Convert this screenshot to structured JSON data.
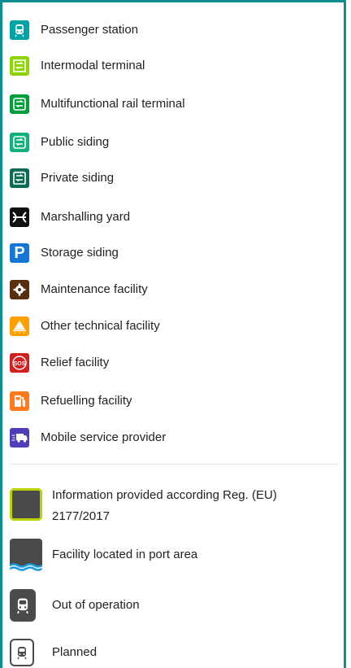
{
  "legend": {
    "items": [
      {
        "label": "Passenger station",
        "icon": "passenger-station-icon",
        "color": "#00a3a6"
      },
      {
        "label": "Intermodal terminal",
        "icon": "intermodal-terminal-icon",
        "color": "#8fd400"
      },
      {
        "label": "Multifunctional rail terminal",
        "icon": "multifunctional-terminal-icon",
        "color": "#009f3c"
      },
      {
        "label": "Public siding",
        "icon": "public-siding-icon",
        "color": "#12b07c"
      },
      {
        "label": "Private siding",
        "icon": "private-siding-icon",
        "color": "#0b6b55"
      },
      {
        "label": "Marshalling yard",
        "icon": "marshalling-yard-icon",
        "color": "#111111"
      },
      {
        "label": "Storage siding",
        "icon": "storage-siding-icon",
        "color": "#1477d6"
      },
      {
        "label": "Maintenance facility",
        "icon": "maintenance-facility-icon",
        "color": "#5a2f0e"
      },
      {
        "label": "Other technical facility",
        "icon": "other-technical-facility-icon",
        "color": "#ff9f00"
      },
      {
        "label": "Relief facility",
        "icon": "relief-facility-icon",
        "color": "#d21f1f"
      },
      {
        "label": "Refuelling facility",
        "icon": "refuelling-facility-icon",
        "color": "#ff7a1a"
      },
      {
        "label": "Mobile service provider",
        "icon": "mobile-service-provider-icon",
        "color": "#4d3db8"
      }
    ],
    "status_items": [
      {
        "label": "Information provided according Reg. (EU) 2177/2017",
        "icon": "regulation-info-icon"
      },
      {
        "label": "Facility located in port area",
        "icon": "port-area-icon"
      },
      {
        "label": "Out of operation",
        "icon": "out-of-operation-icon"
      },
      {
        "label": "Planned",
        "icon": "planned-icon"
      }
    ]
  }
}
